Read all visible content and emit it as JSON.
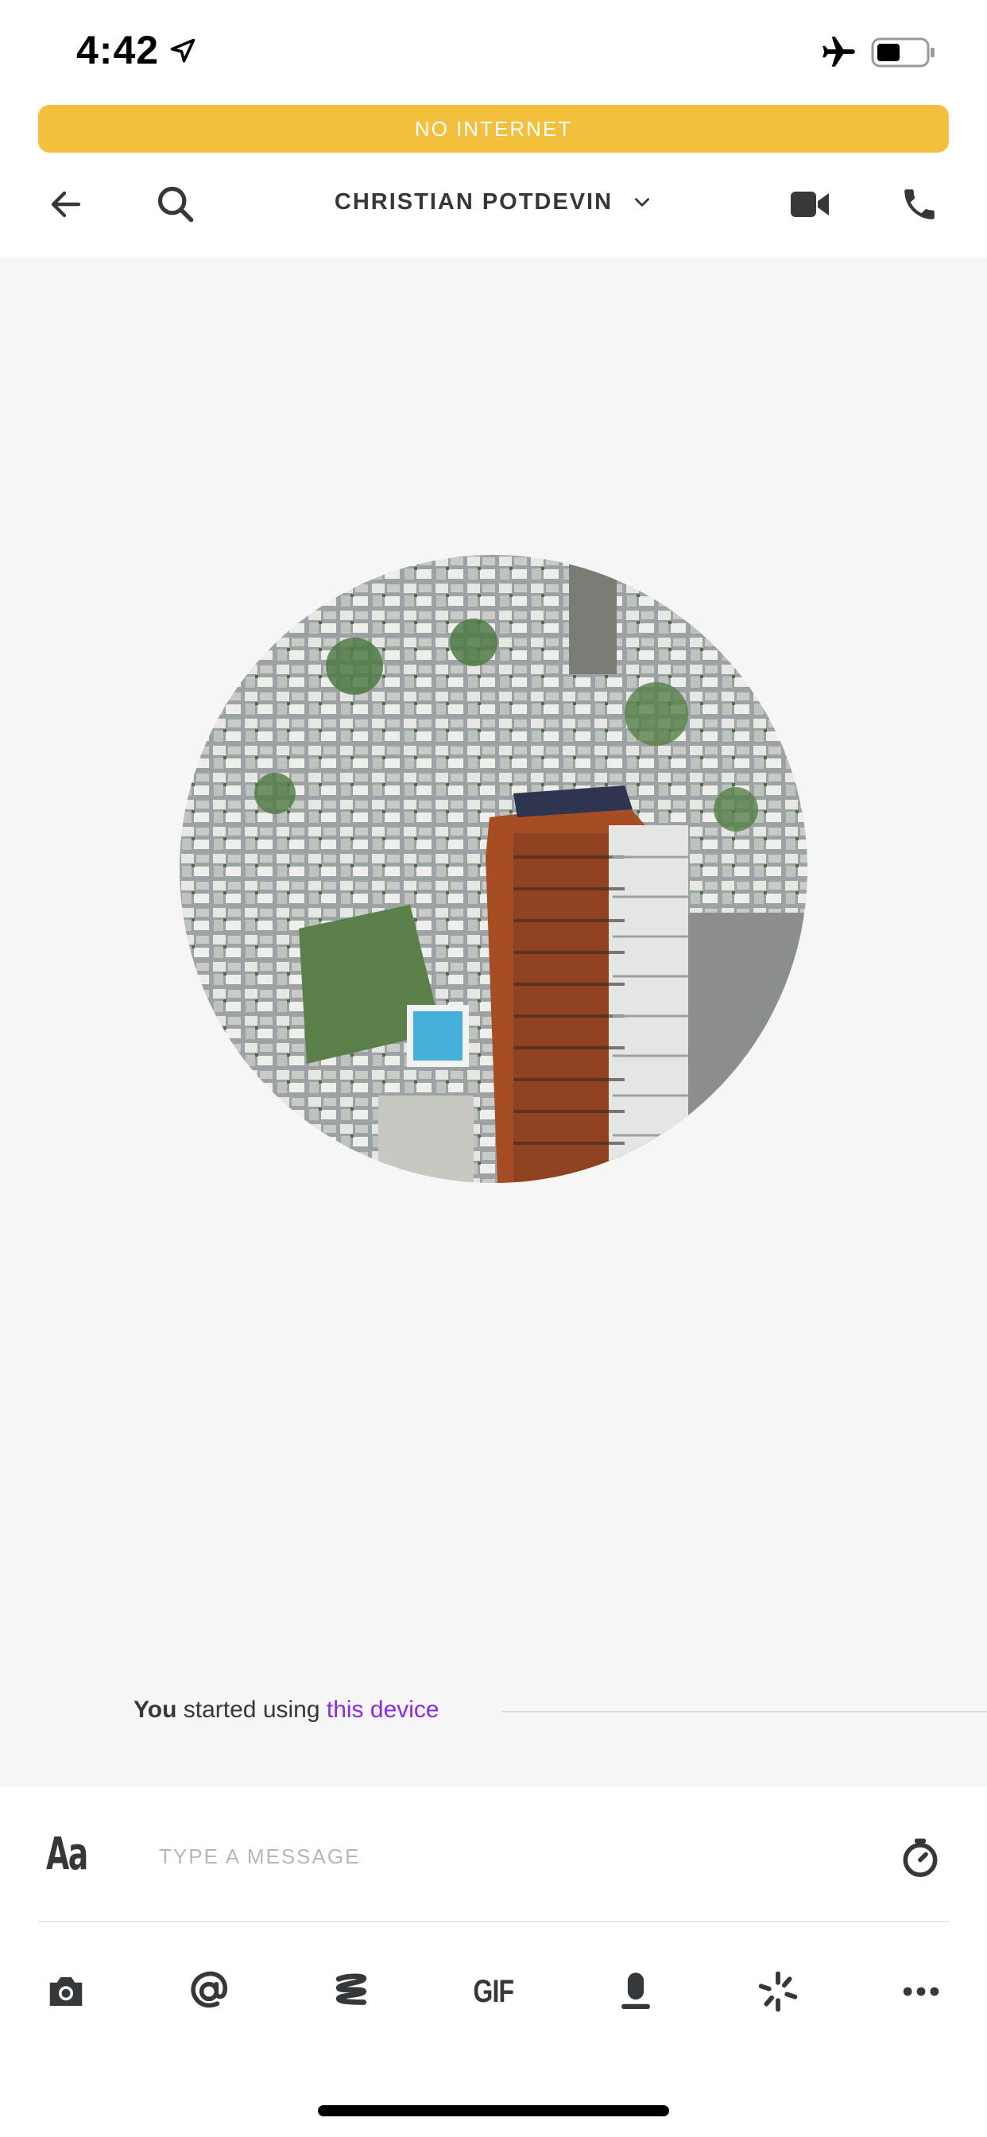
{
  "status_bar": {
    "time": "4:42"
  },
  "banner": {
    "text": "NO INTERNET"
  },
  "header": {
    "title": "CHRISTIAN POTDEVIN"
  },
  "conversation": {
    "system_message": {
      "actor": "You",
      "text": " started using ",
      "link": "this device"
    }
  },
  "composer": {
    "format_label": "Aa",
    "placeholder": "TYPE A MESSAGE",
    "gif_label": "GIF"
  },
  "icons": {
    "back": "back-arrow-icon",
    "search": "search-icon",
    "video": "video-camera-icon",
    "call": "phone-icon",
    "timer": "timer-icon",
    "camera": "camera-icon",
    "mention": "mention-icon",
    "sketch": "sketch-icon",
    "audio": "microphone-icon",
    "ping": "ping-icon",
    "more": "more-icon"
  },
  "colors": {
    "banner": "#f3c03e",
    "accent_link": "#8a2be2",
    "text": "#34383b",
    "background": "#f6f6f6"
  }
}
